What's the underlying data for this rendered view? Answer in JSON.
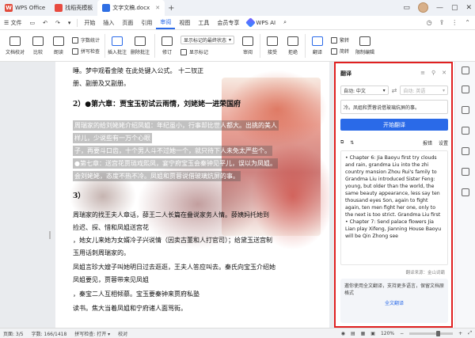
{
  "titlebar": {
    "tabs": [
      {
        "label": "WPS Office"
      },
      {
        "label": "找稻壳模板"
      },
      {
        "label": "文字文稿.docx"
      }
    ],
    "logo_letter": "W"
  },
  "menubar": {
    "file": "☰ 文件",
    "items": [
      "开始",
      "插入",
      "页面",
      "引用",
      "审阅",
      "视图",
      "工具",
      "会员专享"
    ],
    "active": "审阅",
    "ai": "WPS AI"
  },
  "ribbon": {
    "doc_check": "文档校对",
    "compare": "比较",
    "read_aloud": "朗读",
    "word_count": "字数统计",
    "spell_check": "拼写检查",
    "insert_annotation": "插入批注",
    "delete_annotation": "删除批注",
    "revise": "修订",
    "display_select": "显示标记的最终状态",
    "display_markup": "显示标记",
    "review": "审阅",
    "accept": "接受",
    "reject": "拒绝",
    "translate": "翻译",
    "cn_trad": "繁转",
    "cn_simp": "简转",
    "restrict_edit": "限制编辑"
  },
  "document": {
    "lines": [
      "睡。梦中观看金陵 在此处键入公式。 十二钗正",
      "册、副册及又副册。",
      "2）●第六章：贾宝玉初试云雨情，刘姥姥一进荣国府",
      "周瑞家的给刘姥姥介绍凤姐：年纪虽小，行事却比世人都大。出挑的美人",
      "样儿，少说些有一万个心眼",
      "子，再要斗口齿，十个男人斗不过她一个，就只待下人未免太严些个。",
      "●第七章：送宫花贾琏戏熙凤，宴宁府宝玉会秦钟见平儿，误以为凤姐。",
      "会刘姥姥，态度不热不冷。凤姐和贾蓉说借玻璃炕屏的事。",
      "3）",
      "周瑞家的找王夫人章话，薛王二人长篇在叠说家务人情。薛姨妈托她到",
      "捡迟、探、惜和凤姐送宫花",
      "，她女儿来她为女婿冷子兴说情（因卖古董和人打官司）；给黛玉送宫制",
      "玉用话刺周瑞家的。",
      "凤姐言珍大嫂子叫她明日过去逛逛，王夫人答应叫去。秦氏向宝玉介绍她",
      "凤姐要见，贾蓉带来见凤姐",
      "，秦宝二人互相倾慕。宝玉要秦钟来贾府私塾",
      "读书。焦大当着凤姐和宁府诸人面骂街。"
    ]
  },
  "translate_panel": {
    "title": "翻译",
    "source_lang": "自动: 中文",
    "target_lang": "自动: 英语",
    "source_text": "冷。凤姐和贾蓉说借玻璃炕屏的事。",
    "translate_button": "开始翻译",
    "report": "报错",
    "settings": "设置",
    "result": "• Chapter 6: Jia Baoyu first try clouds and rain, grandma Liu into the zhi country mansion Zhou Rui's family to Grandma Liu introduced Sister Feng: young, but older than the world, the same beauty appearance, less say ten thousand eyes Son, again to fight again, ten men fight her one, only to the next is too strict. Grandma Liu first • Chapter 7: Send palace flowers Jia Lian play Xifeng, Jianning House Baoyu will be Qin Zhong see",
    "source_note": "翻译来源：金山词霸",
    "notice": "邀你使用全文翻译，支持更多语言，保留文档原格式",
    "notice_link": "全文翻译"
  },
  "statusbar": {
    "page": "页面: 3/5",
    "words": "字数: 166/1418",
    "spell": "拼写检查: 打开 ▾",
    "proof": "校对",
    "zoom": "120%"
  }
}
